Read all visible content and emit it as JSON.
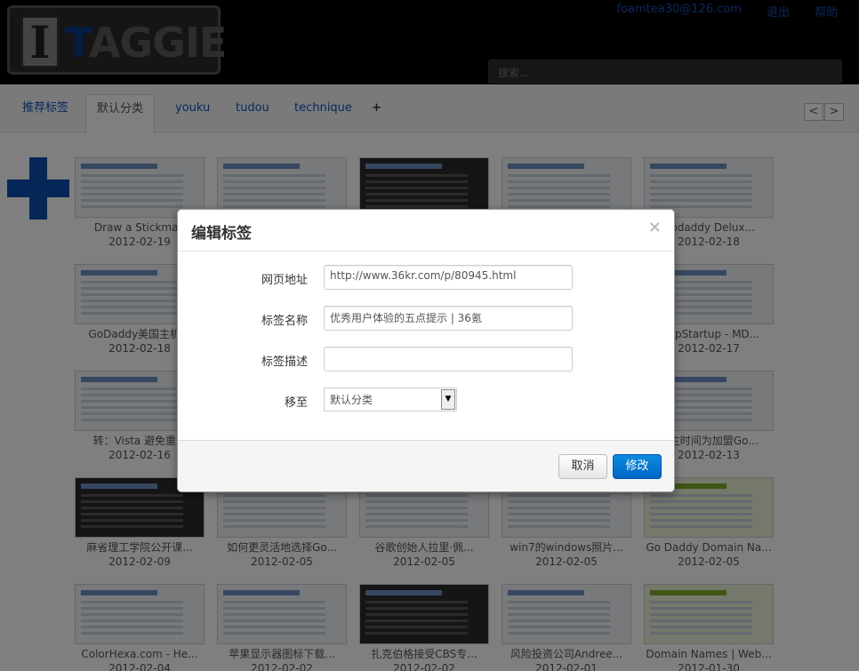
{
  "header": {
    "logo_letter": "I",
    "logo_t": "T",
    "logo_rest": "AGGIE",
    "user_email": "foamtea30@126.com",
    "logout": "退出",
    "help": "帮助",
    "search_placeholder": "搜索..."
  },
  "tabs": [
    {
      "label": "推荐标签"
    },
    {
      "label": "默认分类"
    },
    {
      "label": "youku"
    },
    {
      "label": "tudou"
    },
    {
      "label": "technique"
    },
    {
      "label": "+"
    }
  ],
  "pager": {
    "prev": "<",
    "next": ">"
  },
  "cards": [
    {
      "title": "Draw a Stickman",
      "date": "2012-02-19",
      "style": "light"
    },
    {
      "title": "",
      "date": "",
      "style": "light"
    },
    {
      "title": "",
      "date": "",
      "style": "dark"
    },
    {
      "title": "",
      "date": "",
      "style": "light"
    },
    {
      "title": "Godaddy Delux...",
      "date": "2012-02-18",
      "style": "light"
    },
    {
      "title": "GoDaddy美国主机...",
      "date": "2012-02-18",
      "style": "light"
    },
    {
      "title": "",
      "date": "",
      "style": "light"
    },
    {
      "title": "",
      "date": "",
      "style": "light"
    },
    {
      "title": "",
      "date": "",
      "style": "light"
    },
    {
      "title": "...ppStartup - MD...",
      "date": "2012-02-17",
      "style": "light"
    },
    {
      "title": "转：Vista 避免重...",
      "date": "2012-02-16",
      "style": "light"
    },
    {
      "title": "",
      "date": "",
      "style": "light"
    },
    {
      "title": "",
      "date": "",
      "style": "light"
    },
    {
      "title": "",
      "date": "",
      "style": "light"
    },
    {
      "title": "...主时间为加盟Go...",
      "date": "2012-02-13",
      "style": "light"
    },
    {
      "title": "麻省理工学院公开课...",
      "date": "2012-02-09",
      "style": "dark"
    },
    {
      "title": "如何更灵活地选择Go...",
      "date": "2012-02-05",
      "style": "light"
    },
    {
      "title": "谷歌创始人拉里·佩...",
      "date": "2012-02-05",
      "style": "light"
    },
    {
      "title": "win7的windows照片...",
      "date": "2012-02-05",
      "style": "light"
    },
    {
      "title": "Go Daddy Domain Na...",
      "date": "2012-02-05",
      "style": "green"
    },
    {
      "title": "ColorHexa.com - He...",
      "date": "2012-02-04",
      "style": "light"
    },
    {
      "title": "苹果显示器图标下载...",
      "date": "2012-02-02",
      "style": "light"
    },
    {
      "title": "扎克伯格接受CBS专...",
      "date": "2012-02-02",
      "style": "dark"
    },
    {
      "title": "风险投资公司Andree...",
      "date": "2012-02-01",
      "style": "light"
    },
    {
      "title": "Domain Names | Web...",
      "date": "2012-01-30",
      "style": "green"
    }
  ],
  "modal": {
    "title": "编辑标签",
    "close": "×",
    "url_label": "网页地址",
    "url_value": "http://www.36kr.com/p/80945.html",
    "name_label": "标签名称",
    "name_value": "优秀用户体验的五点提示 | 36氪",
    "desc_label": "标签描述",
    "desc_value": "",
    "move_label": "移至",
    "move_value": "默认分类",
    "cancel": "取消",
    "save": "修改"
  }
}
